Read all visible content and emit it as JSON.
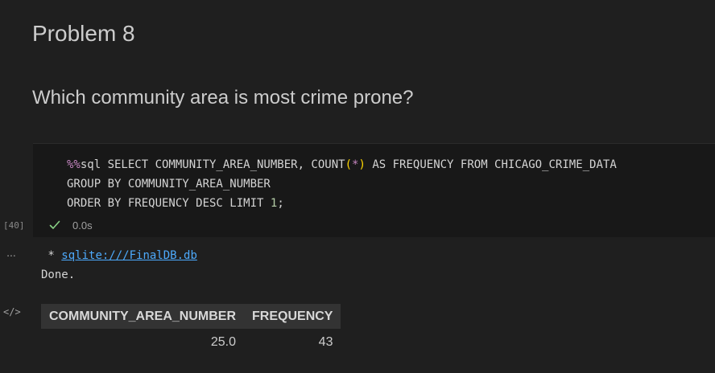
{
  "markdown": {
    "heading": "Problem 8",
    "question": "Which community area is most crime prone?"
  },
  "code_cell": {
    "magic": "%%",
    "line1_rest": "sql SELECT COMMUNITY_AREA_NUMBER, COUNT",
    "line1_paren_open": "(",
    "line1_star": "*",
    "line1_paren_close": ")",
    "line1_tail": " AS FREQUENCY FROM CHICAGO_CRIME_DATA",
    "line2": "GROUP BY COMMUNITY_AREA_NUMBER",
    "line3_head": "ORDER BY FREQUENCY DESC LIMIT ",
    "line3_num": "1",
    "line3_tail": ";",
    "execution_count": "[40]",
    "status_icon": "check-icon",
    "duration": "0.0s"
  },
  "output": {
    "more_glyph": "...",
    "code_icon_glyph": "</>",
    "db_prefix": " * ",
    "db_link": "sqlite:///FinalDB.db",
    "done_text": "Done.",
    "table": {
      "headers": [
        "COMMUNITY_AREA_NUMBER",
        "FREQUENCY"
      ],
      "rows": [
        [
          "25.0",
          "43"
        ]
      ]
    }
  },
  "colors": {
    "background": "#1f1f1f",
    "code_background": "#181818",
    "link": "#4daafc",
    "success": "#89d185",
    "magic": "#c586c0",
    "bracket": "#ffd700"
  }
}
